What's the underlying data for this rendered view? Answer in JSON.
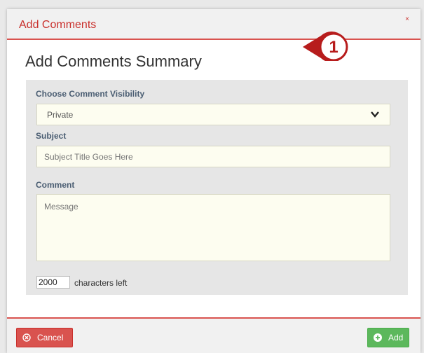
{
  "modal": {
    "title": "Add Comments",
    "close_label": "×",
    "summary_title": "Add Comments Summary",
    "step_number": "1"
  },
  "form": {
    "visibility_label": "Choose Comment Visibility",
    "visibility_value": "Private",
    "subject_label": "Subject",
    "subject_placeholder": "Subject Title Goes Here",
    "comment_label": "Comment",
    "comment_placeholder": "Message",
    "chars_left_value": "2000",
    "chars_left_label": "characters left"
  },
  "footer": {
    "cancel_label": "Cancel",
    "add_label": "Add"
  },
  "colors": {
    "accent_red": "#d9534f",
    "success_green": "#5cb85c",
    "field_bg": "#fdfdf0"
  },
  "icons": {
    "cancel": "circle-x-icon",
    "add": "circle-plus-icon",
    "dropdown": "chevron-down-icon",
    "callout": "step-badge-icon"
  }
}
